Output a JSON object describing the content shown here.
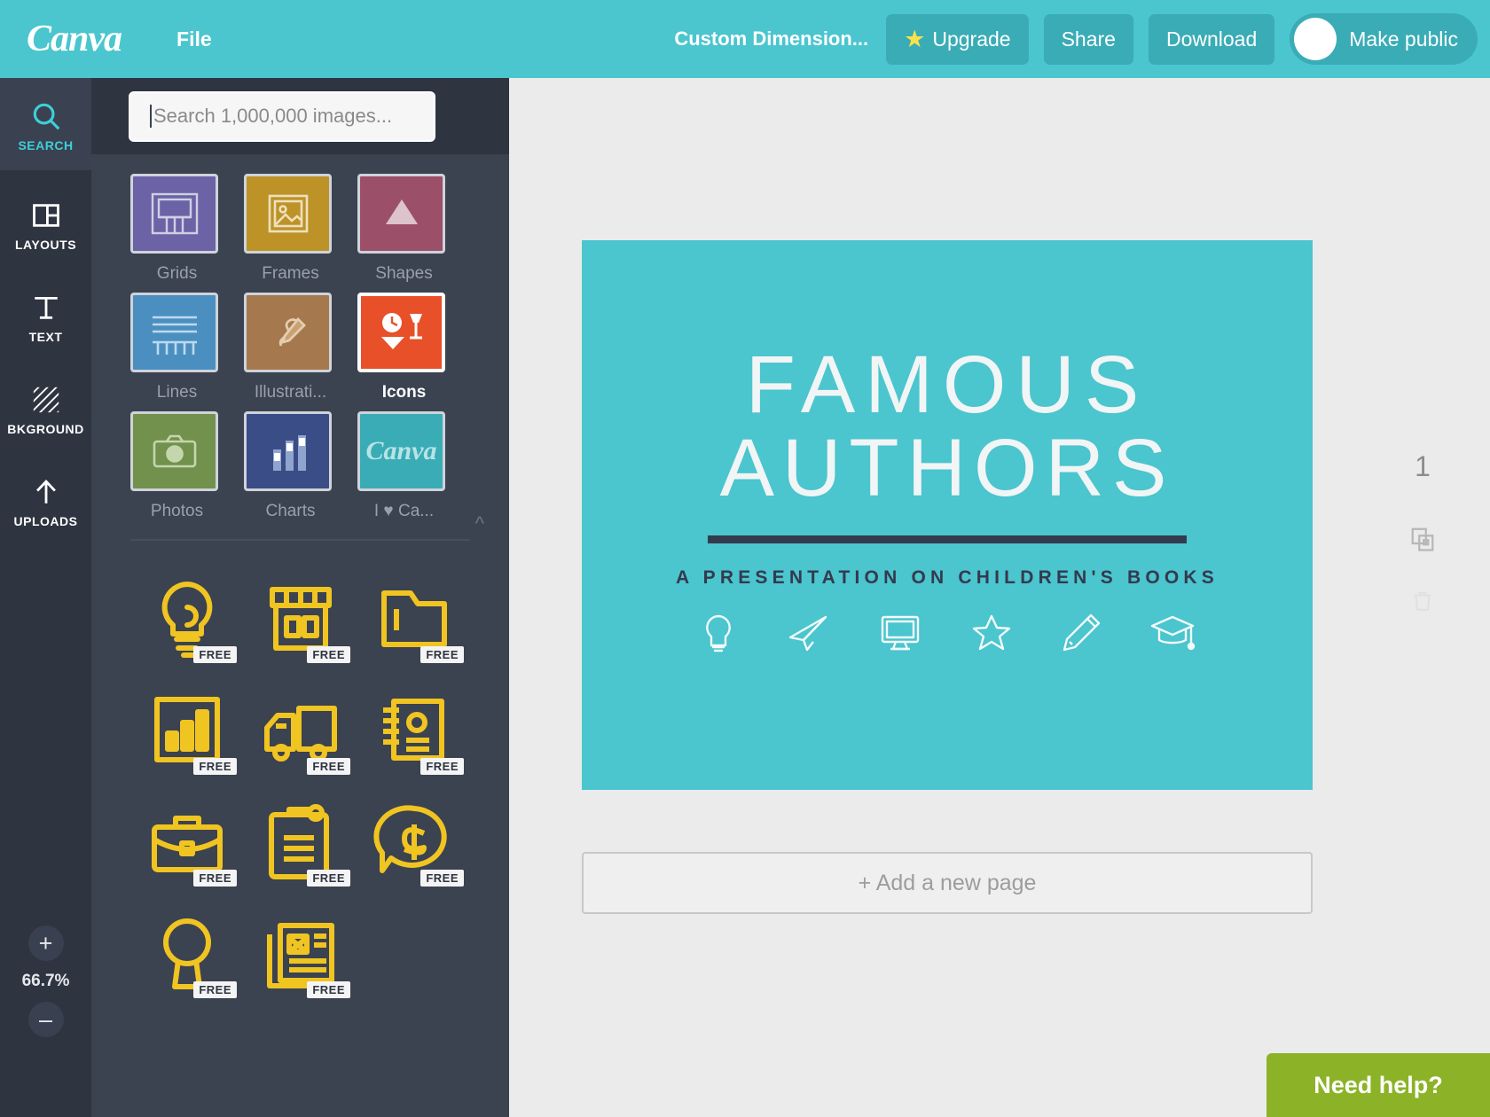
{
  "topbar": {
    "logo": "Canva",
    "file_label": "File",
    "dimension_label": "Custom Dimension...",
    "upgrade_label": "Upgrade",
    "upgrade_icon": "star-icon",
    "share_label": "Share",
    "download_label": "Download",
    "make_public_label": "Make public",
    "brand_color": "#4bc5ce",
    "button_color": "#3aacb6",
    "star_color": "#f7e24c"
  },
  "rail": {
    "items": [
      {
        "label": "SEARCH",
        "icon": "search-icon",
        "active": true
      },
      {
        "label": "LAYOUTS",
        "icon": "layouts-icon",
        "active": false
      },
      {
        "label": "TEXT",
        "icon": "text-icon",
        "active": false
      },
      {
        "label": "BKGROUND",
        "icon": "background-icon",
        "active": false
      },
      {
        "label": "UPLOADS",
        "icon": "uploads-icon",
        "active": false
      }
    ],
    "active_color": "#3ecfd8"
  },
  "zoom": {
    "in_label": "+",
    "out_label": "–",
    "level": "66.7%"
  },
  "panel": {
    "search": {
      "placeholder": "Search 1,000,000 images...",
      "value": ""
    },
    "tiles": [
      {
        "label": "Grids",
        "icon": "grids-icon",
        "color": "#6b63a5",
        "selected": false
      },
      {
        "label": "Frames",
        "icon": "frames-icon",
        "color": "#bd9327",
        "selected": false
      },
      {
        "label": "Shapes",
        "icon": "shapes-icon",
        "color": "#9c4f68",
        "selected": false
      },
      {
        "label": "Lines",
        "icon": "lines-icon",
        "color": "#4b8fc0",
        "selected": false
      },
      {
        "label": "Illustrati...",
        "icon": "illustrations-icon",
        "color": "#a5794d",
        "selected": false
      },
      {
        "label": "Icons",
        "icon": "icons-icon",
        "color": "#e8502a",
        "selected": true
      },
      {
        "label": "Photos",
        "icon": "photos-icon",
        "color": "#72914c",
        "selected": false
      },
      {
        "label": "Charts",
        "icon": "charts-icon",
        "color": "#3a4d86",
        "selected": false
      },
      {
        "label": "I ♥ Ca...",
        "icon": "i-love-canva-icon",
        "color": "#3aacb6",
        "selected": false
      }
    ],
    "collapse_icon": "chevron-up-icon",
    "results": {
      "badge_label": "FREE",
      "items": [
        {
          "icon": "lightbulb-icon",
          "free": true
        },
        {
          "icon": "shop-icon",
          "free": true
        },
        {
          "icon": "folder-icon",
          "free": true
        },
        {
          "icon": "bar-chart-icon",
          "free": true
        },
        {
          "icon": "truck-icon",
          "free": true
        },
        {
          "icon": "address-book-icon",
          "free": true
        },
        {
          "icon": "briefcase-icon",
          "free": true
        },
        {
          "icon": "clipboard-icon",
          "free": true
        },
        {
          "icon": "dollar-chat-icon",
          "free": true
        },
        {
          "icon": "magnifier-icon",
          "free": true
        },
        {
          "icon": "news-icon",
          "free": true
        }
      ]
    }
  },
  "canvas": {
    "design": {
      "background_color": "#4bc5ce",
      "title_line1": "FAMOUS",
      "title_line2": "AUTHORS",
      "rule_color": "#343a4e",
      "subtitle": "A PRESENTATION ON CHILDREN'S BOOKS",
      "icons": [
        "lightbulb-outline-icon",
        "paper-plane-icon",
        "monitor-icon",
        "star-outline-icon",
        "pencil-icon",
        "graduation-cap-icon"
      ]
    },
    "page_number": "1",
    "duplicate_icon": "duplicate-page-icon",
    "delete_icon": "trash-icon",
    "add_page_label": "+ Add a new page"
  },
  "help": {
    "label": "Need help?",
    "color": "#8cb327"
  }
}
